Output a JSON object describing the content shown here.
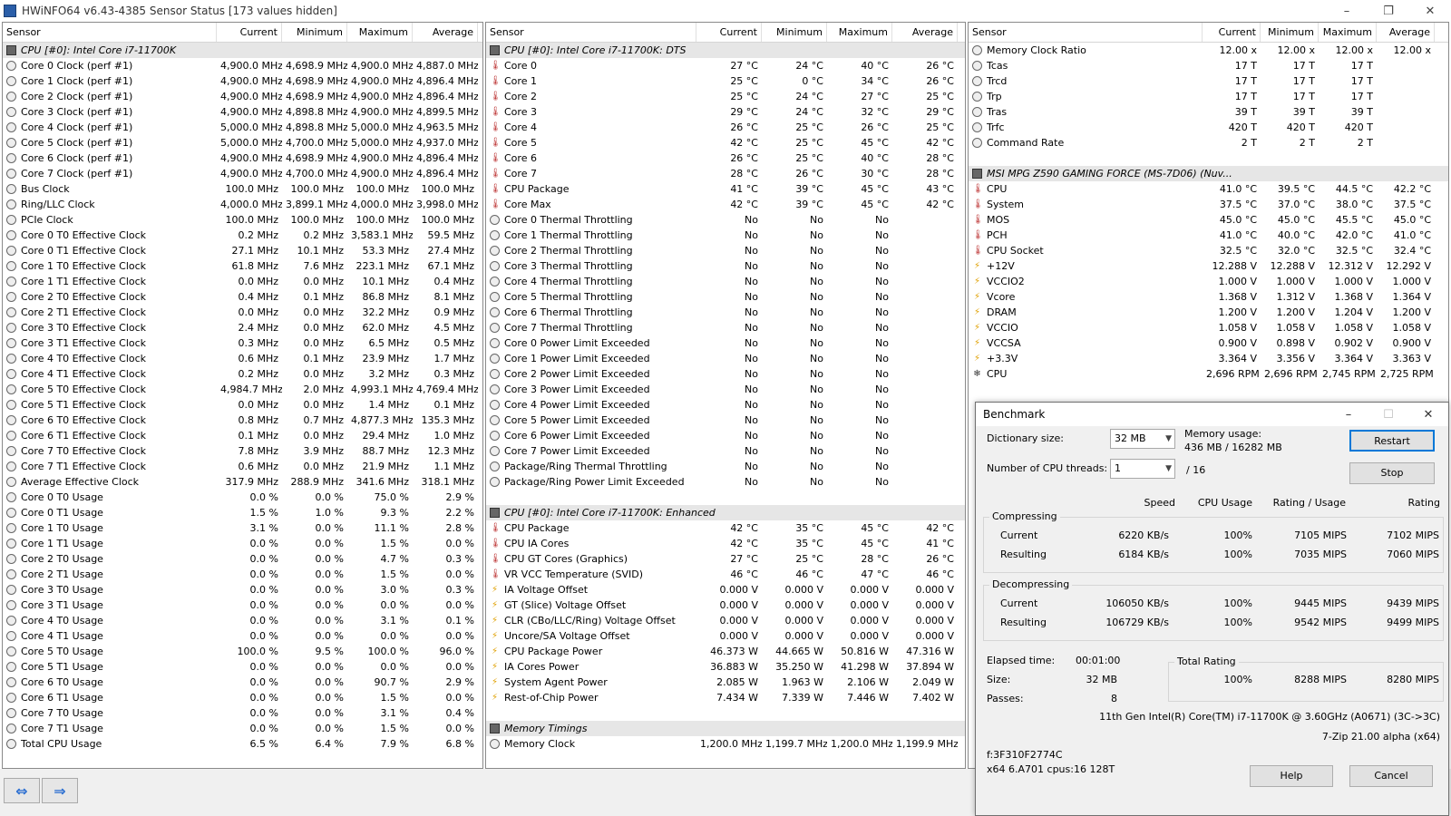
{
  "window": {
    "title": "HWiNFO64 v6.43-4385 Sensor Status [173 values hidden]"
  },
  "headers": {
    "sensor": "Sensor",
    "current": "Current",
    "minimum": "Minimum",
    "maximum": "Maximum",
    "average": "Average"
  },
  "panel1": [
    {
      "t": "group",
      "name": "CPU [#0]: Intel Core i7-11700K"
    },
    {
      "i": "clock",
      "name": "Core 0 Clock (perf #1)",
      "cur": "4,900.0 MHz",
      "min": "4,698.9 MHz",
      "max": "4,900.0 MHz",
      "avg": "4,887.0 MHz"
    },
    {
      "i": "clock",
      "name": "Core 1 Clock (perf #1)",
      "cur": "4,900.0 MHz",
      "min": "4,698.9 MHz",
      "max": "4,900.0 MHz",
      "avg": "4,896.4 MHz"
    },
    {
      "i": "clock",
      "name": "Core 2 Clock (perf #1)",
      "cur": "4,900.0 MHz",
      "min": "4,698.9 MHz",
      "max": "4,900.0 MHz",
      "avg": "4,896.4 MHz"
    },
    {
      "i": "clock",
      "name": "Core 3 Clock (perf #1)",
      "cur": "4,900.0 MHz",
      "min": "4,898.8 MHz",
      "max": "4,900.0 MHz",
      "avg": "4,899.5 MHz"
    },
    {
      "i": "clock",
      "name": "Core 4 Clock (perf #1)",
      "cur": "5,000.0 MHz",
      "min": "4,898.8 MHz",
      "max": "5,000.0 MHz",
      "avg": "4,963.5 MHz"
    },
    {
      "i": "clock",
      "name": "Core 5 Clock (perf #1)",
      "cur": "5,000.0 MHz",
      "min": "4,700.0 MHz",
      "max": "5,000.0 MHz",
      "avg": "4,937.0 MHz"
    },
    {
      "i": "clock",
      "name": "Core 6 Clock (perf #1)",
      "cur": "4,900.0 MHz",
      "min": "4,698.9 MHz",
      "max": "4,900.0 MHz",
      "avg": "4,896.4 MHz"
    },
    {
      "i": "clock",
      "name": "Core 7 Clock (perf #1)",
      "cur": "4,900.0 MHz",
      "min": "4,700.0 MHz",
      "max": "4,900.0 MHz",
      "avg": "4,896.4 MHz"
    },
    {
      "i": "clock",
      "name": "Bus Clock",
      "cur": "100.0 MHz",
      "min": "100.0 MHz",
      "max": "100.0 MHz",
      "avg": "100.0 MHz"
    },
    {
      "i": "clock",
      "name": "Ring/LLC Clock",
      "cur": "4,000.0 MHz",
      "min": "3,899.1 MHz",
      "max": "4,000.0 MHz",
      "avg": "3,998.0 MHz"
    },
    {
      "i": "clock",
      "name": "PCIe Clock",
      "cur": "100.0 MHz",
      "min": "100.0 MHz",
      "max": "100.0 MHz",
      "avg": "100.0 MHz"
    },
    {
      "i": "clock",
      "name": "Core 0 T0 Effective Clock",
      "cur": "0.2 MHz",
      "min": "0.2 MHz",
      "max": "3,583.1 MHz",
      "avg": "59.5 MHz"
    },
    {
      "i": "clock",
      "name": "Core 0 T1 Effective Clock",
      "cur": "27.1 MHz",
      "min": "10.1 MHz",
      "max": "53.3 MHz",
      "avg": "27.4 MHz"
    },
    {
      "i": "clock",
      "name": "Core 1 T0 Effective Clock",
      "cur": "61.8 MHz",
      "min": "7.6 MHz",
      "max": "223.1 MHz",
      "avg": "67.1 MHz"
    },
    {
      "i": "clock",
      "name": "Core 1 T1 Effective Clock",
      "cur": "0.0 MHz",
      "min": "0.0 MHz",
      "max": "10.1 MHz",
      "avg": "0.4 MHz"
    },
    {
      "i": "clock",
      "name": "Core 2 T0 Effective Clock",
      "cur": "0.4 MHz",
      "min": "0.1 MHz",
      "max": "86.8 MHz",
      "avg": "8.1 MHz"
    },
    {
      "i": "clock",
      "name": "Core 2 T1 Effective Clock",
      "cur": "0.0 MHz",
      "min": "0.0 MHz",
      "max": "32.2 MHz",
      "avg": "0.9 MHz"
    },
    {
      "i": "clock",
      "name": "Core 3 T0 Effective Clock",
      "cur": "2.4 MHz",
      "min": "0.0 MHz",
      "max": "62.0 MHz",
      "avg": "4.5 MHz"
    },
    {
      "i": "clock",
      "name": "Core 3 T1 Effective Clock",
      "cur": "0.3 MHz",
      "min": "0.0 MHz",
      "max": "6.5 MHz",
      "avg": "0.5 MHz"
    },
    {
      "i": "clock",
      "name": "Core 4 T0 Effective Clock",
      "cur": "0.6 MHz",
      "min": "0.1 MHz",
      "max": "23.9 MHz",
      "avg": "1.7 MHz"
    },
    {
      "i": "clock",
      "name": "Core 4 T1 Effective Clock",
      "cur": "0.2 MHz",
      "min": "0.0 MHz",
      "max": "3.2 MHz",
      "avg": "0.3 MHz"
    },
    {
      "i": "clock",
      "name": "Core 5 T0 Effective Clock",
      "cur": "4,984.7 MHz",
      "min": "2.0 MHz",
      "max": "4,993.1 MHz",
      "avg": "4,769.4 MHz"
    },
    {
      "i": "clock",
      "name": "Core 5 T1 Effective Clock",
      "cur": "0.0 MHz",
      "min": "0.0 MHz",
      "max": "1.4 MHz",
      "avg": "0.1 MHz"
    },
    {
      "i": "clock",
      "name": "Core 6 T0 Effective Clock",
      "cur": "0.8 MHz",
      "min": "0.7 MHz",
      "max": "4,877.3 MHz",
      "avg": "135.3 MHz"
    },
    {
      "i": "clock",
      "name": "Core 6 T1 Effective Clock",
      "cur": "0.1 MHz",
      "min": "0.0 MHz",
      "max": "29.4 MHz",
      "avg": "1.0 MHz"
    },
    {
      "i": "clock",
      "name": "Core 7 T0 Effective Clock",
      "cur": "7.8 MHz",
      "min": "3.9 MHz",
      "max": "88.7 MHz",
      "avg": "12.3 MHz"
    },
    {
      "i": "clock",
      "name": "Core 7 T1 Effective Clock",
      "cur": "0.6 MHz",
      "min": "0.0 MHz",
      "max": "21.9 MHz",
      "avg": "1.1 MHz"
    },
    {
      "i": "clock",
      "name": "Average Effective Clock",
      "cur": "317.9 MHz",
      "min": "288.9 MHz",
      "max": "341.6 MHz",
      "avg": "318.1 MHz"
    },
    {
      "i": "clock",
      "name": "Core 0 T0 Usage",
      "cur": "0.0 %",
      "min": "0.0 %",
      "max": "75.0 %",
      "avg": "2.9 %"
    },
    {
      "i": "clock",
      "name": "Core 0 T1 Usage",
      "cur": "1.5 %",
      "min": "1.0 %",
      "max": "9.3 %",
      "avg": "2.2 %"
    },
    {
      "i": "clock",
      "name": "Core 1 T0 Usage",
      "cur": "3.1 %",
      "min": "0.0 %",
      "max": "11.1 %",
      "avg": "2.8 %"
    },
    {
      "i": "clock",
      "name": "Core 1 T1 Usage",
      "cur": "0.0 %",
      "min": "0.0 %",
      "max": "1.5 %",
      "avg": "0.0 %"
    },
    {
      "i": "clock",
      "name": "Core 2 T0 Usage",
      "cur": "0.0 %",
      "min": "0.0 %",
      "max": "4.7 %",
      "avg": "0.3 %"
    },
    {
      "i": "clock",
      "name": "Core 2 T1 Usage",
      "cur": "0.0 %",
      "min": "0.0 %",
      "max": "1.5 %",
      "avg": "0.0 %"
    },
    {
      "i": "clock",
      "name": "Core 3 T0 Usage",
      "cur": "0.0 %",
      "min": "0.0 %",
      "max": "3.0 %",
      "avg": "0.3 %"
    },
    {
      "i": "clock",
      "name": "Core 3 T1 Usage",
      "cur": "0.0 %",
      "min": "0.0 %",
      "max": "0.0 %",
      "avg": "0.0 %"
    },
    {
      "i": "clock",
      "name": "Core 4 T0 Usage",
      "cur": "0.0 %",
      "min": "0.0 %",
      "max": "3.1 %",
      "avg": "0.1 %"
    },
    {
      "i": "clock",
      "name": "Core 4 T1 Usage",
      "cur": "0.0 %",
      "min": "0.0 %",
      "max": "0.0 %",
      "avg": "0.0 %"
    },
    {
      "i": "clock",
      "name": "Core 5 T0 Usage",
      "cur": "100.0 %",
      "min": "9.5 %",
      "max": "100.0 %",
      "avg": "96.0 %"
    },
    {
      "i": "clock",
      "name": "Core 5 T1 Usage",
      "cur": "0.0 %",
      "min": "0.0 %",
      "max": "0.0 %",
      "avg": "0.0 %"
    },
    {
      "i": "clock",
      "name": "Core 6 T0 Usage",
      "cur": "0.0 %",
      "min": "0.0 %",
      "max": "90.7 %",
      "avg": "2.9 %"
    },
    {
      "i": "clock",
      "name": "Core 6 T1 Usage",
      "cur": "0.0 %",
      "min": "0.0 %",
      "max": "1.5 %",
      "avg": "0.0 %"
    },
    {
      "i": "clock",
      "name": "Core 7 T0 Usage",
      "cur": "0.0 %",
      "min": "0.0 %",
      "max": "3.1 %",
      "avg": "0.4 %"
    },
    {
      "i": "clock",
      "name": "Core 7 T1 Usage",
      "cur": "0.0 %",
      "min": "0.0 %",
      "max": "1.5 %",
      "avg": "0.0 %"
    },
    {
      "i": "clock",
      "name": "Total CPU Usage",
      "cur": "6.5 %",
      "min": "6.4 %",
      "max": "7.9 %",
      "avg": "6.8 %"
    }
  ],
  "panel2": [
    {
      "t": "group",
      "name": "CPU [#0]: Intel Core i7-11700K: DTS"
    },
    {
      "i": "temp",
      "name": "Core 0",
      "cur": "27 °C",
      "min": "24 °C",
      "max": "40 °C",
      "avg": "26 °C"
    },
    {
      "i": "temp",
      "name": "Core 1",
      "cur": "25 °C",
      "min": "0 °C",
      "max": "34 °C",
      "avg": "26 °C"
    },
    {
      "i": "temp",
      "name": "Core 2",
      "cur": "25 °C",
      "min": "24 °C",
      "max": "27 °C",
      "avg": "25 °C"
    },
    {
      "i": "temp",
      "name": "Core 3",
      "cur": "29 °C",
      "min": "24 °C",
      "max": "32 °C",
      "avg": "29 °C"
    },
    {
      "i": "temp",
      "name": "Core 4",
      "cur": "26 °C",
      "min": "25 °C",
      "max": "26 °C",
      "avg": "25 °C"
    },
    {
      "i": "temp",
      "name": "Core 5",
      "cur": "42 °C",
      "min": "25 °C",
      "max": "45 °C",
      "avg": "42 °C"
    },
    {
      "i": "temp",
      "name": "Core 6",
      "cur": "26 °C",
      "min": "25 °C",
      "max": "40 °C",
      "avg": "28 °C"
    },
    {
      "i": "temp",
      "name": "Core 7",
      "cur": "28 °C",
      "min": "26 °C",
      "max": "30 °C",
      "avg": "28 °C"
    },
    {
      "i": "temp",
      "name": "CPU Package",
      "cur": "41 °C",
      "min": "39 °C",
      "max": "45 °C",
      "avg": "43 °C"
    },
    {
      "i": "temp",
      "name": "Core Max",
      "cur": "42 °C",
      "min": "39 °C",
      "max": "45 °C",
      "avg": "42 °C"
    },
    {
      "i": "clock",
      "name": "Core 0 Thermal Throttling",
      "cur": "No",
      "min": "No",
      "max": "No",
      "avg": ""
    },
    {
      "i": "clock",
      "name": "Core 1 Thermal Throttling",
      "cur": "No",
      "min": "No",
      "max": "No",
      "avg": ""
    },
    {
      "i": "clock",
      "name": "Core 2 Thermal Throttling",
      "cur": "No",
      "min": "No",
      "max": "No",
      "avg": ""
    },
    {
      "i": "clock",
      "name": "Core 3 Thermal Throttling",
      "cur": "No",
      "min": "No",
      "max": "No",
      "avg": ""
    },
    {
      "i": "clock",
      "name": "Core 4 Thermal Throttling",
      "cur": "No",
      "min": "No",
      "max": "No",
      "avg": ""
    },
    {
      "i": "clock",
      "name": "Core 5 Thermal Throttling",
      "cur": "No",
      "min": "No",
      "max": "No",
      "avg": ""
    },
    {
      "i": "clock",
      "name": "Core 6 Thermal Throttling",
      "cur": "No",
      "min": "No",
      "max": "No",
      "avg": ""
    },
    {
      "i": "clock",
      "name": "Core 7 Thermal Throttling",
      "cur": "No",
      "min": "No",
      "max": "No",
      "avg": ""
    },
    {
      "i": "clock",
      "name": "Core 0 Power Limit Exceeded",
      "cur": "No",
      "min": "No",
      "max": "No",
      "avg": ""
    },
    {
      "i": "clock",
      "name": "Core 1 Power Limit Exceeded",
      "cur": "No",
      "min": "No",
      "max": "No",
      "avg": ""
    },
    {
      "i": "clock",
      "name": "Core 2 Power Limit Exceeded",
      "cur": "No",
      "min": "No",
      "max": "No",
      "avg": ""
    },
    {
      "i": "clock",
      "name": "Core 3 Power Limit Exceeded",
      "cur": "No",
      "min": "No",
      "max": "No",
      "avg": ""
    },
    {
      "i": "clock",
      "name": "Core 4 Power Limit Exceeded",
      "cur": "No",
      "min": "No",
      "max": "No",
      "avg": ""
    },
    {
      "i": "clock",
      "name": "Core 5 Power Limit Exceeded",
      "cur": "No",
      "min": "No",
      "max": "No",
      "avg": ""
    },
    {
      "i": "clock",
      "name": "Core 6 Power Limit Exceeded",
      "cur": "No",
      "min": "No",
      "max": "No",
      "avg": ""
    },
    {
      "i": "clock",
      "name": "Core 7 Power Limit Exceeded",
      "cur": "No",
      "min": "No",
      "max": "No",
      "avg": ""
    },
    {
      "i": "clock",
      "name": "Package/Ring Thermal Throttling",
      "cur": "No",
      "min": "No",
      "max": "No",
      "avg": ""
    },
    {
      "i": "clock",
      "name": "Package/Ring Power Limit Exceeded",
      "cur": "No",
      "min": "No",
      "max": "No",
      "avg": ""
    },
    {
      "t": "blank"
    },
    {
      "t": "group",
      "name": "CPU [#0]: Intel Core i7-11700K: Enhanced"
    },
    {
      "i": "temp",
      "name": "CPU Package",
      "cur": "42 °C",
      "min": "35 °C",
      "max": "45 °C",
      "avg": "42 °C"
    },
    {
      "i": "temp",
      "name": "CPU IA Cores",
      "cur": "42 °C",
      "min": "35 °C",
      "max": "45 °C",
      "avg": "41 °C"
    },
    {
      "i": "temp",
      "name": "CPU GT Cores (Graphics)",
      "cur": "27 °C",
      "min": "25 °C",
      "max": "28 °C",
      "avg": "26 °C"
    },
    {
      "i": "temp",
      "name": "VR VCC Temperature (SVID)",
      "cur": "46 °C",
      "min": "46 °C",
      "max": "47 °C",
      "avg": "46 °C"
    },
    {
      "i": "volt",
      "name": "IA Voltage Offset",
      "cur": "0.000 V",
      "min": "0.000 V",
      "max": "0.000 V",
      "avg": "0.000 V"
    },
    {
      "i": "volt",
      "name": "GT (Slice) Voltage Offset",
      "cur": "0.000 V",
      "min": "0.000 V",
      "max": "0.000 V",
      "avg": "0.000 V"
    },
    {
      "i": "volt",
      "name": "CLR (CBo/LLC/Ring) Voltage Offset",
      "cur": "0.000 V",
      "min": "0.000 V",
      "max": "0.000 V",
      "avg": "0.000 V"
    },
    {
      "i": "volt",
      "name": "Uncore/SA Voltage Offset",
      "cur": "0.000 V",
      "min": "0.000 V",
      "max": "0.000 V",
      "avg": "0.000 V"
    },
    {
      "i": "volt",
      "name": "CPU Package Power",
      "cur": "46.373 W",
      "min": "44.665 W",
      "max": "50.816 W",
      "avg": "47.316 W"
    },
    {
      "i": "volt",
      "name": "IA Cores Power",
      "cur": "36.883 W",
      "min": "35.250 W",
      "max": "41.298 W",
      "avg": "37.894 W"
    },
    {
      "i": "volt",
      "name": "System Agent Power",
      "cur": "2.085 W",
      "min": "1.963 W",
      "max": "2.106 W",
      "avg": "2.049 W"
    },
    {
      "i": "volt",
      "name": "Rest-of-Chip Power",
      "cur": "7.434 W",
      "min": "7.339 W",
      "max": "7.446 W",
      "avg": "7.402 W"
    },
    {
      "t": "blank"
    },
    {
      "t": "group",
      "name": "Memory Timings"
    },
    {
      "i": "clock",
      "name": "Memory Clock",
      "cur": "1,200.0 MHz",
      "min": "1,199.7 MHz",
      "max": "1,200.0 MHz",
      "avg": "1,199.9 MHz"
    }
  ],
  "panel3": [
    {
      "i": "clock",
      "name": "Memory Clock Ratio",
      "cur": "12.00 x",
      "min": "12.00 x",
      "max": "12.00 x",
      "avg": "12.00 x"
    },
    {
      "i": "clock",
      "name": "Tcas",
      "cur": "17 T",
      "min": "17 T",
      "max": "17 T",
      "avg": ""
    },
    {
      "i": "clock",
      "name": "Trcd",
      "cur": "17 T",
      "min": "17 T",
      "max": "17 T",
      "avg": ""
    },
    {
      "i": "clock",
      "name": "Trp",
      "cur": "17 T",
      "min": "17 T",
      "max": "17 T",
      "avg": ""
    },
    {
      "i": "clock",
      "name": "Tras",
      "cur": "39 T",
      "min": "39 T",
      "max": "39 T",
      "avg": ""
    },
    {
      "i": "clock",
      "name": "Trfc",
      "cur": "420 T",
      "min": "420 T",
      "max": "420 T",
      "avg": ""
    },
    {
      "i": "clock",
      "name": "Command Rate",
      "cur": "2 T",
      "min": "2 T",
      "max": "2 T",
      "avg": ""
    },
    {
      "t": "blank"
    },
    {
      "t": "group",
      "name": "MSI MPG Z590 GAMING FORCE (MS-7D06) (Nuv..."
    },
    {
      "i": "temp",
      "name": "CPU",
      "cur": "41.0 °C",
      "min": "39.5 °C",
      "max": "44.5 °C",
      "avg": "42.2 °C"
    },
    {
      "i": "temp",
      "name": "System",
      "cur": "37.5 °C",
      "min": "37.0 °C",
      "max": "38.0 °C",
      "avg": "37.5 °C"
    },
    {
      "i": "temp",
      "name": "MOS",
      "cur": "45.0 °C",
      "min": "45.0 °C",
      "max": "45.5 °C",
      "avg": "45.0 °C"
    },
    {
      "i": "temp",
      "name": "PCH",
      "cur": "41.0 °C",
      "min": "40.0 °C",
      "max": "42.0 °C",
      "avg": "41.0 °C"
    },
    {
      "i": "temp",
      "name": "CPU Socket",
      "cur": "32.5 °C",
      "min": "32.0 °C",
      "max": "32.5 °C",
      "avg": "32.4 °C"
    },
    {
      "i": "volt",
      "name": "+12V",
      "cur": "12.288 V",
      "min": "12.288 V",
      "max": "12.312 V",
      "avg": "12.292 V"
    },
    {
      "i": "volt",
      "name": "VCCIO2",
      "cur": "1.000 V",
      "min": "1.000 V",
      "max": "1.000 V",
      "avg": "1.000 V"
    },
    {
      "i": "volt",
      "name": "Vcore",
      "cur": "1.368 V",
      "min": "1.312 V",
      "max": "1.368 V",
      "avg": "1.364 V"
    },
    {
      "i": "volt",
      "name": "DRAM",
      "cur": "1.200 V",
      "min": "1.200 V",
      "max": "1.204 V",
      "avg": "1.200 V"
    },
    {
      "i": "volt",
      "name": "VCCIO",
      "cur": "1.058 V",
      "min": "1.058 V",
      "max": "1.058 V",
      "avg": "1.058 V"
    },
    {
      "i": "volt",
      "name": "VCCSA",
      "cur": "0.900 V",
      "min": "0.898 V",
      "max": "0.902 V",
      "avg": "0.900 V"
    },
    {
      "i": "volt",
      "name": "+3.3V",
      "cur": "3.364 V",
      "min": "3.356 V",
      "max": "3.364 V",
      "avg": "3.363 V"
    },
    {
      "i": "fan",
      "name": "CPU",
      "cur": "2,696 RPM",
      "min": "2,696 RPM",
      "max": "2,745 RPM",
      "avg": "2,725 RPM"
    }
  ],
  "benchmark": {
    "title": "Benchmark",
    "dict_label": "Dictionary size:",
    "dict_value": "32 MB",
    "threads_label": "Number of CPU threads:",
    "threads_value": "1",
    "threads_total": "/ 16",
    "mem_label": "Memory usage:",
    "mem_value": "436 MB / 16282 MB",
    "restart": "Restart",
    "stop": "Stop",
    "col_speed": "Speed",
    "col_cpu": "CPU Usage",
    "col_ru": "Rating / Usage",
    "col_rating": "Rating",
    "compressing": "Compressing",
    "decompressing": "Decompressing",
    "comp_current": {
      "label": "Current",
      "speed": "6220 KB/s",
      "cpu": "100%",
      "ru": "7105 MIPS",
      "rating": "7102 MIPS"
    },
    "comp_result": {
      "label": "Resulting",
      "speed": "6184 KB/s",
      "cpu": "100%",
      "ru": "7035 MIPS",
      "rating": "7060 MIPS"
    },
    "dec_current": {
      "label": "Current",
      "speed": "106050 KB/s",
      "cpu": "100%",
      "ru": "9445 MIPS",
      "rating": "9439 MIPS"
    },
    "dec_result": {
      "label": "Resulting",
      "speed": "106729 KB/s",
      "cpu": "100%",
      "ru": "9542 MIPS",
      "rating": "9499 MIPS"
    },
    "elapsed_label": "Elapsed time:",
    "elapsed_value": "00:01:00",
    "size_label": "Size:",
    "size_value": "32 MB",
    "passes_label": "Passes:",
    "passes_value": "8",
    "total_label": "Total Rating",
    "total_cpu": "100%",
    "total_ru": "8288 MIPS",
    "total_rating": "8280 MIPS",
    "cpu_info": "11th Gen Intel(R) Core(TM) i7-11700K @ 3.60GHz (A0671) (3C->3C)",
    "zip_info": "7-Zip 21.00 alpha (x64)",
    "sys1": "f:3F310F2774C",
    "sys2": "x64 6.A701 cpus:16 128T",
    "help": "Help",
    "cancel": "Cancel"
  }
}
